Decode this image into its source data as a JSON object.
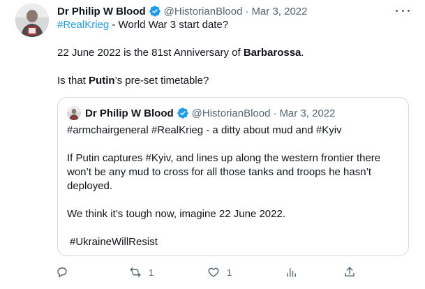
{
  "author": {
    "name": "Dr Philip W Blood",
    "handle": "@HistorianBlood",
    "date": "Mar 3, 2022"
  },
  "tweet": {
    "line1_hashtag": "#RealKrieg",
    "line1_rest": " - World War 3 start date?",
    "line2_pre": "22 June 2022 is the 81st Anniversary of ",
    "line2_bold": "Barbarossa",
    "line2_post": ".",
    "line3_pre": "Is that ",
    "line3_bold": "Putin",
    "line3_post": "’s pre-set timetable?"
  },
  "quoted": {
    "name": "Dr Philip W Blood",
    "handle": "@HistorianBlood",
    "date": "Mar 3, 2022",
    "line1": "#armchairgeneral #RealKrieg - a ditty about mud and #Kyiv",
    "line2": "If Putin captures #Kyiv, and lines up along the western frontier there",
    "line3": "won’t be any mud to cross for all those tanks and troops he hasn’t",
    "line4": "deployed.",
    "line5": "We think it’s tough now, imagine 22 June 2022.",
    "line6": "#UkraineWillResist"
  },
  "actions": {
    "reply_count": "",
    "retweet_count": "1",
    "like_count": "1"
  },
  "icons": {
    "verified": "verified-badge-icon",
    "more": "more-icon",
    "reply": "reply-icon",
    "retweet": "retweet-icon",
    "like": "heart-icon",
    "views": "views-icon",
    "share": "share-icon"
  },
  "colors": {
    "link": "#1d9bf0",
    "muted": "#536471",
    "text": "#0f1419",
    "border": "#cfd9de"
  }
}
